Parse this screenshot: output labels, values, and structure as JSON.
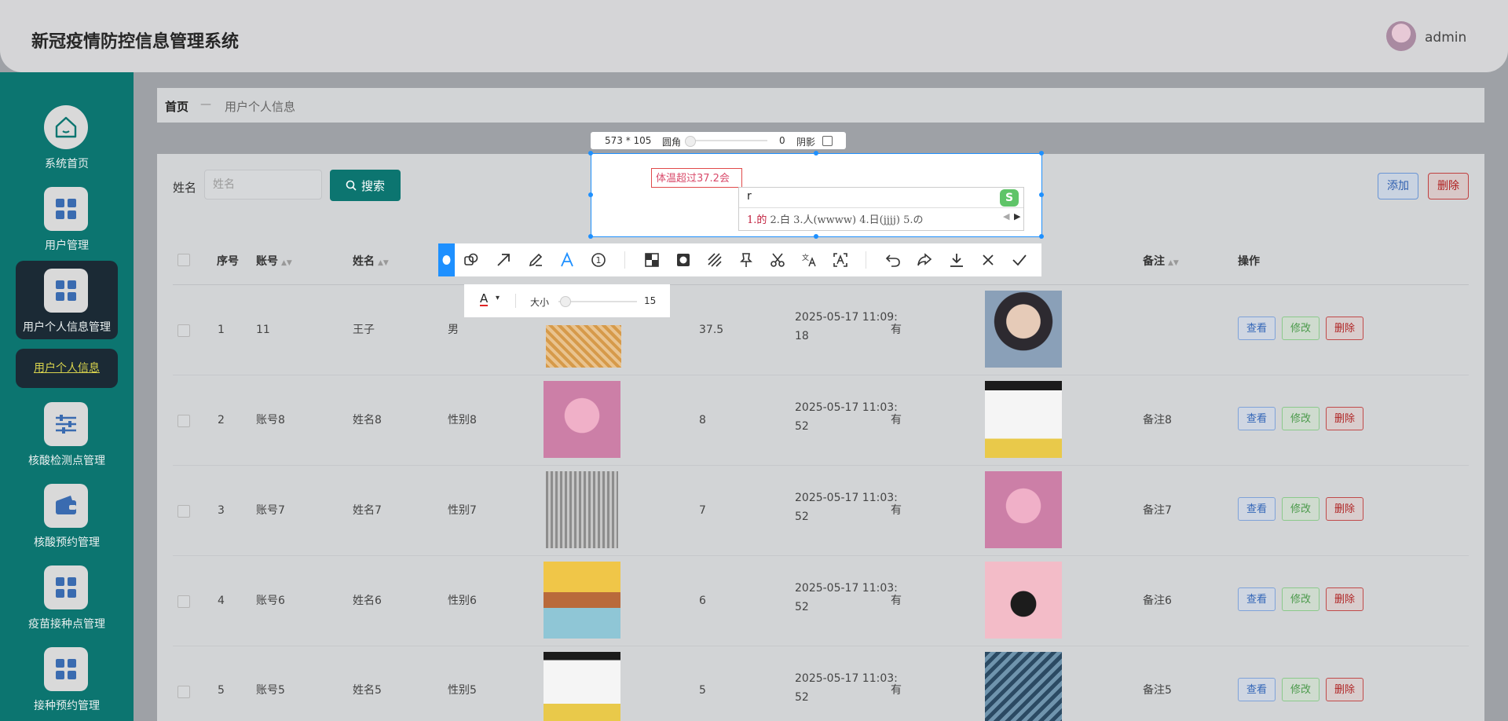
{
  "header": {
    "title": "新冠疫情防控信息管理系统",
    "user": "admin"
  },
  "sidebar": {
    "items": [
      {
        "label": "系统首页",
        "icon": "home-icon"
      },
      {
        "label": "用户管理",
        "icon": "grid-icon"
      },
      {
        "label": "用户个人信息管理",
        "icon": "grid-icon"
      },
      {
        "label": "核酸检测点管理",
        "icon": "sliders-icon"
      },
      {
        "label": "核酸预约管理",
        "icon": "wallet-icon"
      },
      {
        "label": "疫苗接种点管理",
        "icon": "grid-icon"
      },
      {
        "label": "接种预约管理",
        "icon": "grid-icon"
      }
    ],
    "sub_active": "用户个人信息"
  },
  "breadcrumb": {
    "home": "首页",
    "sep": "—",
    "current": "用户个人信息"
  },
  "search": {
    "label": "姓名",
    "placeholder": "姓名",
    "button": "搜索"
  },
  "actions": {
    "add": "添加",
    "delete": "删除"
  },
  "table": {
    "headers": {
      "index": "序号",
      "account": "账号",
      "name": "姓名",
      "remark": "备注",
      "ops": "操作"
    },
    "rows": [
      {
        "index": "1",
        "account": "11",
        "name": "王子",
        "gender": "男",
        "temp": "37.5",
        "time1": "2025-05-17 11:09:",
        "time2": "18",
        "flag": "有",
        "remark": ""
      },
      {
        "index": "2",
        "account": "账号8",
        "name": "姓名8",
        "gender": "性别8",
        "temp": "8",
        "time1": "2025-05-17 11:03:",
        "time2": "52",
        "flag": "有",
        "remark": "备注8"
      },
      {
        "index": "3",
        "account": "账号7",
        "name": "姓名7",
        "gender": "性别7",
        "temp": "7",
        "time1": "2025-05-17 11:03:",
        "time2": "52",
        "flag": "有",
        "remark": "备注7"
      },
      {
        "index": "4",
        "account": "账号6",
        "name": "姓名6",
        "gender": "性别6",
        "temp": "6",
        "time1": "2025-05-17 11:03:",
        "time2": "52",
        "flag": "有",
        "remark": "备注6"
      },
      {
        "index": "5",
        "account": "账号5",
        "name": "姓名5",
        "gender": "性别5",
        "temp": "5",
        "time1": "2025-05-17 11:03:",
        "time2": "52",
        "flag": "有",
        "remark": "备注5"
      }
    ],
    "row_ops": {
      "view": "查看",
      "edit": "修改",
      "delete": "删除"
    }
  },
  "capture_tool": {
    "size": "573 * 105",
    "radius_label": "圆角",
    "radius_value": "0",
    "shadow_label": "阴影",
    "annotation_text": "体温超过37.2会",
    "ime_typed": "r",
    "ime_first": "1.的",
    "ime_rest": " 2.白  3.人(wwww)  4.日(jjjj)  5.の",
    "text_size_label": "大小",
    "text_size_value": "15"
  },
  "colors": {
    "sidebar": "#0c7570",
    "accent": "#1e90ff",
    "danger": "#e02424"
  }
}
